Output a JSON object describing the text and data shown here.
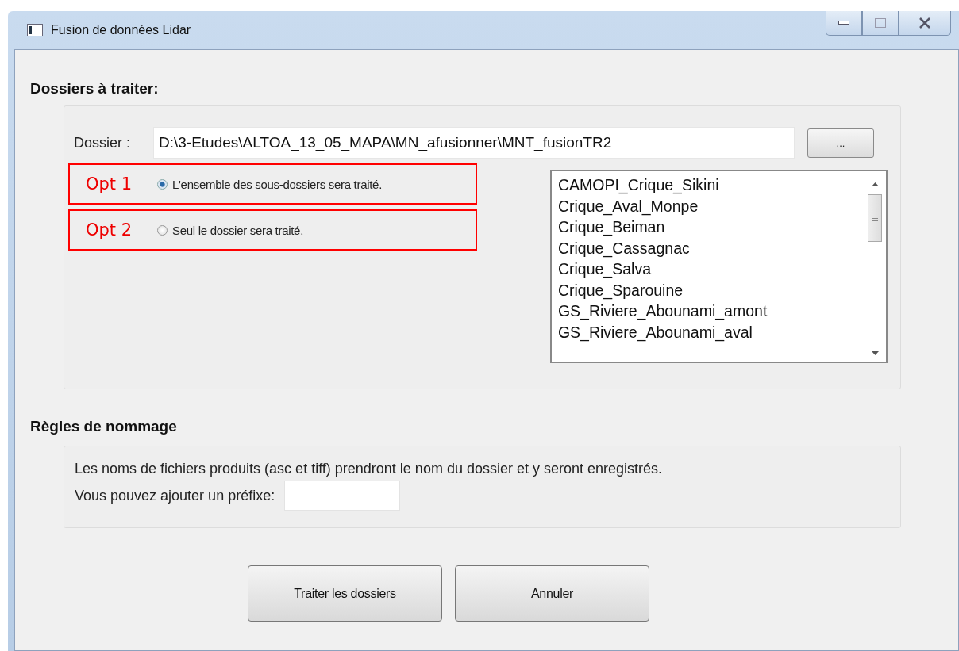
{
  "window": {
    "title": "Fusion de données Lidar"
  },
  "folders_section": {
    "heading": "Dossiers à traiter:",
    "folder_label": "Dossier :",
    "folder_value": "D:\\3-Etudes\\ALTOA_13_05_MAPA\\MN_afusionner\\MNT_fusionTR2",
    "browse_button": "...",
    "options": [
      {
        "annotation": "Opt 1",
        "label": "L'ensemble des sous-dossiers sera traité.",
        "selected": true
      },
      {
        "annotation": "Opt 2",
        "label": "Seul le dossier sera traité.",
        "selected": false
      }
    ],
    "folder_list": [
      "CAMOPI_Crique_Sikini",
      "Crique_Aval_Monpe",
      "Crique_Beiman",
      "Crique_Cassagnac",
      "Crique_Salva",
      "Crique_Sparouine",
      "GS_Riviere_Abounami_amont",
      "GS_Riviere_Abounami_aval"
    ]
  },
  "naming_section": {
    "heading": "Règles de nommage",
    "description": "Les noms de fichiers produits (asc et tiff) prendront le nom du dossier et y seront enregistrés.",
    "prefix_label": "Vous pouvez ajouter un préfixe:"
  },
  "buttons": [
    "Traiter les dossiers",
    "Annuler"
  ]
}
